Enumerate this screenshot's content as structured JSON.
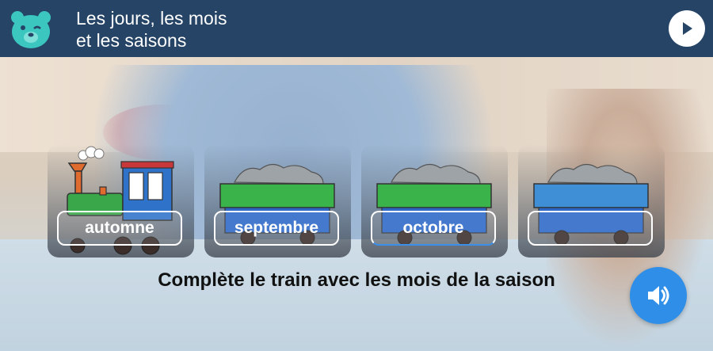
{
  "header": {
    "title_line1": "Les jours, les mois",
    "title_line2": "et les saisons",
    "bg_color": "#254466",
    "logo_icon": "bear-icon",
    "play_icon": "play-icon"
  },
  "train": [
    {
      "kind": "locomotive",
      "label": "automne",
      "color": "#3aa84a"
    },
    {
      "kind": "wagon",
      "label": "septembre",
      "color": "#3ab34a"
    },
    {
      "kind": "wagon",
      "label": "octobre",
      "color": "#3ab34a",
      "active": true
    },
    {
      "kind": "wagon",
      "label": "",
      "color": "#3e8fd6"
    }
  ],
  "instruction": "Complète le train avec les mois de la saison",
  "audio": {
    "icon": "speaker-icon",
    "color": "#2f8fe8"
  }
}
